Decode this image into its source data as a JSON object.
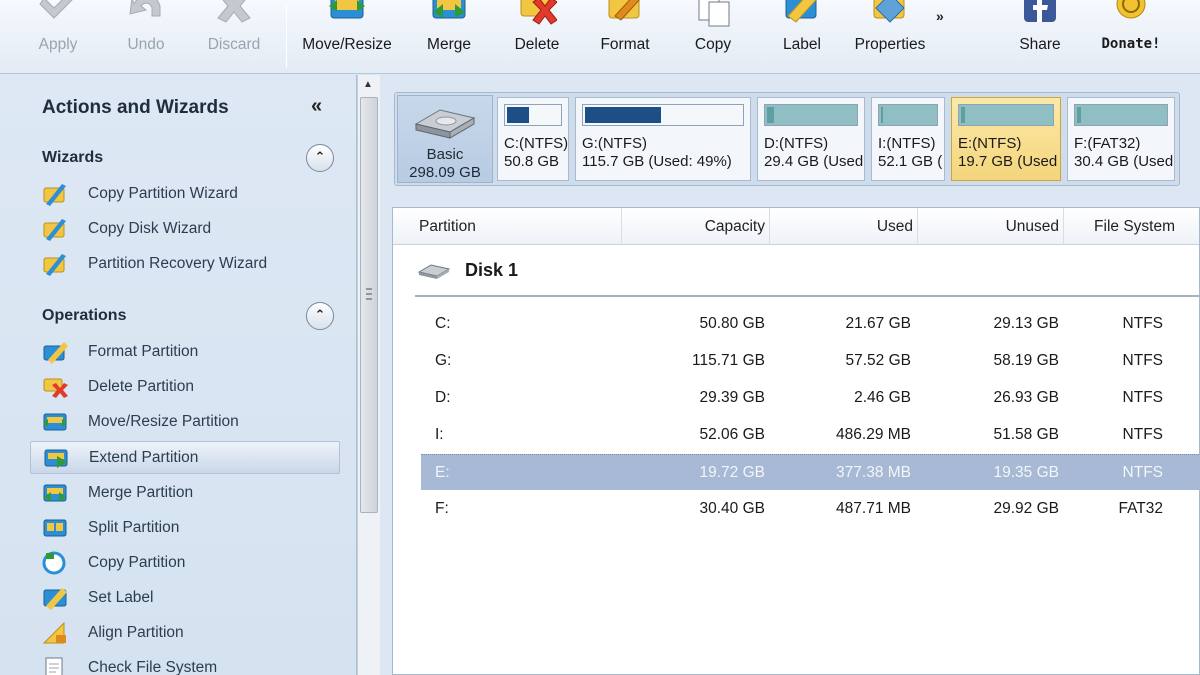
{
  "toolbar": {
    "apply": "Apply",
    "undo": "Undo",
    "discard": "Discard",
    "move_resize": "Move/Resize",
    "merge": "Merge",
    "delete": "Delete",
    "format": "Format",
    "copy": "Copy",
    "label": "Label",
    "properties": "Properties",
    "more": "»",
    "share": "Share",
    "donate": "Donate!"
  },
  "sidebar": {
    "title": "Actions and Wizards",
    "collapse_glyph": "«",
    "toggle_glyph": "⌃",
    "wizards": {
      "title": "Wizards",
      "items": [
        "Copy Partition Wizard",
        "Copy Disk Wizard",
        "Partition Recovery Wizard"
      ]
    },
    "operations": {
      "title": "Operations",
      "items": [
        "Format Partition",
        "Delete Partition",
        "Move/Resize Partition",
        "Extend Partition",
        "Merge Partition",
        "Split Partition",
        "Copy Partition",
        "Set Label",
        "Align Partition",
        "Check File System"
      ],
      "selected": "Extend Partition"
    }
  },
  "disk_map": {
    "disk_type": "Basic",
    "disk_size": "298.09 GB",
    "partitions": [
      {
        "name": "C:(NTFS)",
        "size": "50.8 GB",
        "used_fraction": 0.43
      },
      {
        "name": "G:(NTFS)",
        "size": "115.7 GB (Used: 49%)",
        "used_fraction": 0.49
      },
      {
        "name": "D:(NTFS)",
        "size": "29.4 GB (Used",
        "used_fraction": 0.08
      },
      {
        "name": "I:(NTFS)",
        "size": "52.1 GB (",
        "used_fraction": 0.01
      },
      {
        "name": "E:(NTFS)",
        "size": "19.7 GB (Used",
        "used_fraction": 0.02
      },
      {
        "name": "F:(FAT32)",
        "size": "30.4 GB (Used",
        "used_fraction": 0.02
      }
    ],
    "selected": "E:(NTFS)"
  },
  "partition_table": {
    "columns": [
      "Partition",
      "Capacity",
      "Used",
      "Unused",
      "File System"
    ],
    "disk_name": "Disk 1",
    "rows": [
      {
        "partition": "C:",
        "capacity": "50.80 GB",
        "used": "21.67 GB",
        "unused": "29.13 GB",
        "fs": "NTFS"
      },
      {
        "partition": "G:",
        "capacity": "115.71 GB",
        "used": "57.52 GB",
        "unused": "58.19 GB",
        "fs": "NTFS"
      },
      {
        "partition": "D:",
        "capacity": "29.39 GB",
        "used": "2.46 GB",
        "unused": "26.93 GB",
        "fs": "NTFS"
      },
      {
        "partition": "I:",
        "capacity": "52.06 GB",
        "used": "486.29 MB",
        "unused": "51.58 GB",
        "fs": "NTFS"
      },
      {
        "partition": "E:",
        "capacity": "19.72 GB",
        "used": "377.38 MB",
        "unused": "19.35 GB",
        "fs": "NTFS"
      },
      {
        "partition": "F:",
        "capacity": "30.40 GB",
        "used": "487.71 MB",
        "unused": "29.92 GB",
        "fs": "FAT32"
      }
    ],
    "selected_row": "E:"
  },
  "colors": {
    "bar_fill_dark": "#1d4f86",
    "bar_fill_teal": "#5f9ea3",
    "selection_blue": "#a7b9d4",
    "selection_gold": "#f4d57c"
  }
}
